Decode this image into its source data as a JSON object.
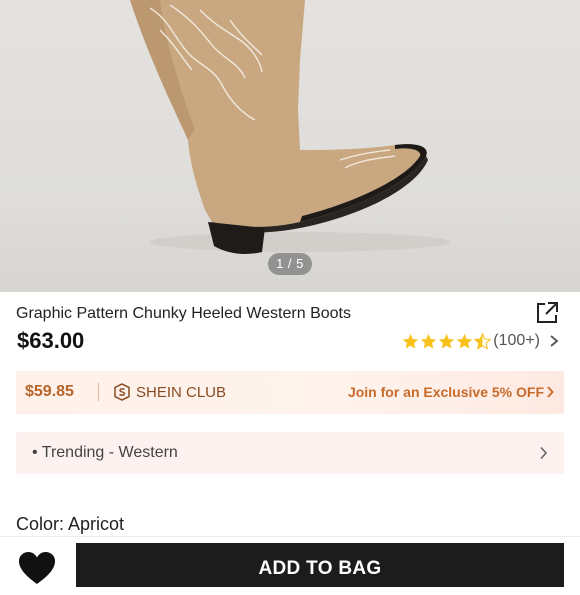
{
  "gallery": {
    "counter": "1 / 5",
    "image_alt": "Tan suede western boot with white embroidery"
  },
  "product": {
    "title": "Graphic Pattern Chunky Heeled Western Boots",
    "price": "$63.00",
    "rating_value": 4.5,
    "rating_count": "(100+)"
  },
  "club": {
    "price": "$59.85",
    "name": "SHEIN CLUB",
    "offer": "Join for an Exclusive 5% OFF"
  },
  "trend": {
    "label": "• Trending - Western"
  },
  "color": {
    "label": "Color: Apricot"
  },
  "actions": {
    "add_to_bag": "ADD TO BAG"
  },
  "icons": {
    "share": "share-icon",
    "star": "star-icon",
    "wishlist": "heart-icon",
    "chevron": "chevron-right-icon",
    "club_logo": "shein-club-logo-icon"
  },
  "colors": {
    "star": "#f8c11c",
    "club_text": "#c86a2a",
    "button_bg": "#1c1c1c"
  }
}
